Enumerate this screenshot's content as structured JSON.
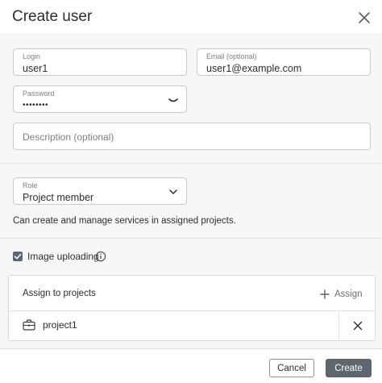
{
  "dialog": {
    "title": "Create user"
  },
  "form": {
    "login": {
      "label": "Login",
      "value": "user1"
    },
    "email": {
      "label": "Email (optional)",
      "value": "user1@example.com"
    },
    "password": {
      "label": "Password",
      "value": "••••••••"
    },
    "description": {
      "placeholder": "Description (optional)"
    },
    "role": {
      "label": "Role",
      "value": "Project member"
    },
    "role_description": "Can create and manage services in assigned projects.",
    "image_uploading": {
      "label": "Image uploading",
      "checked": true
    }
  },
  "projects": {
    "title": "Assign to projects",
    "assign_label": "Assign",
    "items": [
      {
        "name": "project1"
      }
    ]
  },
  "footer": {
    "cancel_label": "Cancel",
    "create_label": "Create"
  },
  "colors": {
    "primary_button": "#5f6670",
    "checkbox": "#5b6877",
    "border": "#c9cbcf"
  },
  "icons": [
    "close-icon",
    "chevron-down-icon",
    "eye-closed-icon",
    "check-icon",
    "info-icon",
    "plus-icon",
    "briefcase-icon"
  ]
}
